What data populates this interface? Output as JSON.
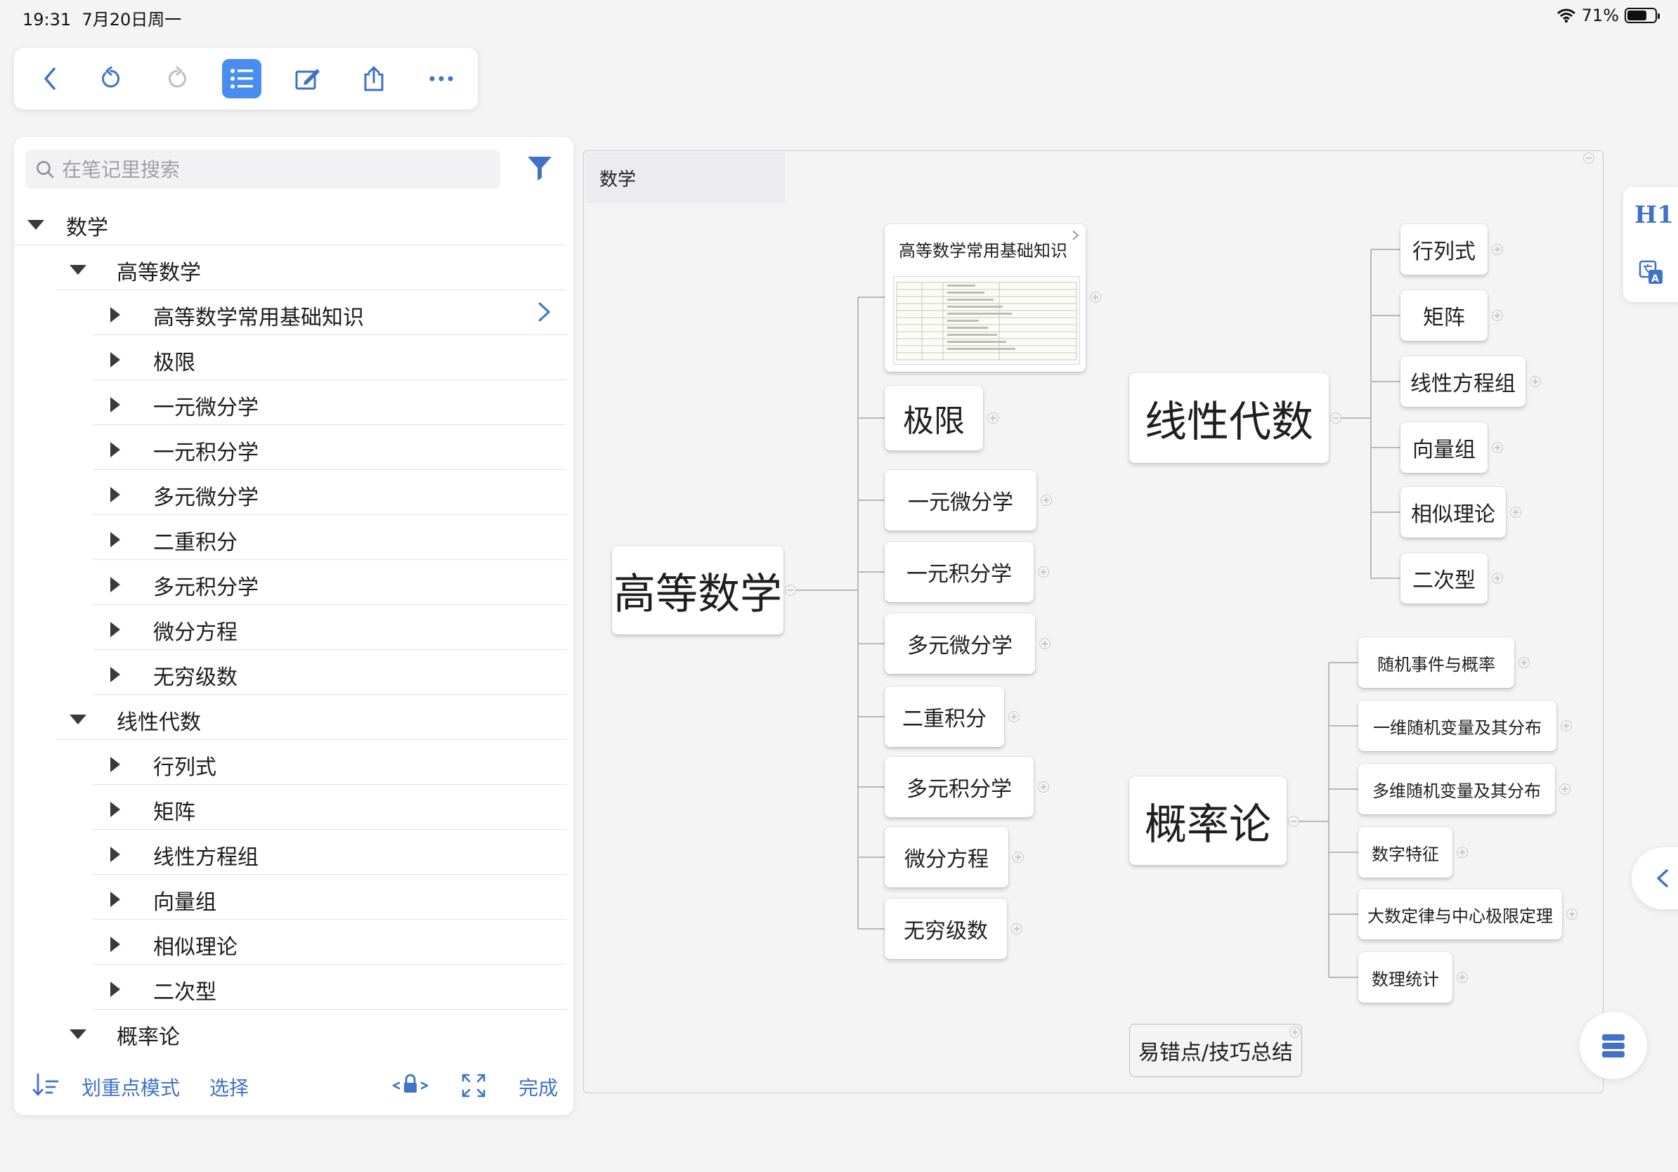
{
  "status_bar": {
    "time": "19:31",
    "date": "7月20日周一",
    "battery": "71%",
    "battery_level": 0.71
  },
  "toolbar": {
    "icons": [
      "back-icon",
      "undo-icon",
      "redo-icon",
      "outline-list-icon",
      "edit-icon",
      "share-icon",
      "more-icon"
    ],
    "accent": "#4a8df0"
  },
  "sidebar": {
    "search_placeholder": "在笔记里搜索",
    "tree": [
      {
        "label": "数学",
        "level": 0,
        "expanded": true
      },
      {
        "label": "高等数学",
        "level": 1,
        "expanded": true
      },
      {
        "label": "高等数学常用基础知识",
        "level": 2,
        "expanded": false,
        "has_link": true
      },
      {
        "label": "极限",
        "level": 2,
        "expanded": false
      },
      {
        "label": "一元微分学",
        "level": 2,
        "expanded": false
      },
      {
        "label": "一元积分学",
        "level": 2,
        "expanded": false
      },
      {
        "label": "多元微分学",
        "level": 2,
        "expanded": false
      },
      {
        "label": "二重积分",
        "level": 2,
        "expanded": false
      },
      {
        "label": "多元积分学",
        "level": 2,
        "expanded": false
      },
      {
        "label": "微分方程",
        "level": 2,
        "expanded": false
      },
      {
        "label": "无穷级数",
        "level": 2,
        "expanded": false
      },
      {
        "label": "线性代数",
        "level": 1,
        "expanded": true
      },
      {
        "label": "行列式",
        "level": 2,
        "expanded": false
      },
      {
        "label": "矩阵",
        "level": 2,
        "expanded": false
      },
      {
        "label": "线性方程组",
        "level": 2,
        "expanded": false
      },
      {
        "label": "向量组",
        "level": 2,
        "expanded": false
      },
      {
        "label": "相似理论",
        "level": 2,
        "expanded": false
      },
      {
        "label": "二次型",
        "level": 2,
        "expanded": false
      },
      {
        "label": "概率论",
        "level": 1,
        "expanded": true
      }
    ],
    "bottom": {
      "highlight_mode": "划重点模式",
      "select": "选择",
      "done": "完成"
    }
  },
  "mindmap": {
    "tab_title": "数学",
    "gaoshu": {
      "root": "高等数学",
      "children": [
        "高等数学常用基础知识",
        "极限",
        "一元微分学",
        "一元积分学",
        "多元微分学",
        "二重积分",
        "多元积分学",
        "微分方程",
        "无穷级数"
      ]
    },
    "xiandai": {
      "root": "线性代数",
      "children": [
        "行列式",
        "矩阵",
        "线性方程组",
        "向量组",
        "相似理论",
        "二次型"
      ]
    },
    "gailv": {
      "root": "概率论",
      "children": [
        "随机事件与概率",
        "一维随机变量及其分布",
        "多维随机变量及其分布",
        "数字特征",
        "大数定律与中心极限定理",
        "数理统计"
      ]
    },
    "extra": "易错点/技巧总结"
  },
  "right_panel": {
    "heading_label": "H1"
  }
}
